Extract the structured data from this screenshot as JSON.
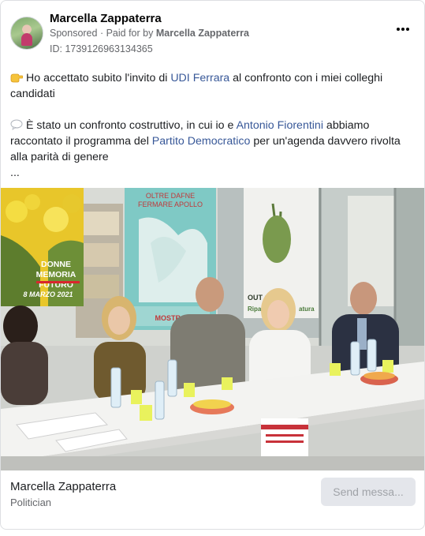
{
  "ad": {
    "advertiser_name": "Marcella Zappaterra",
    "sponsored_label": "Sponsored",
    "paid_for_prefix": "Paid for by",
    "paid_for_name": "Marcella Zappaterra",
    "ad_id": "ID: 1739126963134365",
    "more_icon": "more-options-icon"
  },
  "body": {
    "p1_before": "Ho accettato subito l'invito di ",
    "p1_link": "UDI Ferrara",
    "p1_after": " al confronto con i miei colleghi candidati",
    "p2_before": "È stato un confronto costruttivo, in cui io e ",
    "p2_link1": "Antonio Fiorentini",
    "p2_mid": " abbiamo raccontato il programma del ",
    "p2_link2": "Partito Democratico",
    "p2_after": " per un'agenda davvero rivolta alla parità di genere",
    "ellipsis": "...",
    "link_color": "#385898"
  },
  "photo": {
    "poster_left_line1": "DONNE",
    "poster_left_line2": "MEMORIA",
    "poster_left_line3": "FUTURO",
    "poster_left_date": "8 MARZO 2021",
    "poster_center_line1": "OLTRE DAFNE",
    "poster_center_line2": "FERMARE APOLLO",
    "poster_center_bottom": "MOSTRA",
    "poster_right_text": "OUT OF",
    "poster_right_text2": "Ripar",
    "poster_right_text3": "atura"
  },
  "footer": {
    "page_name": "Marcella Zappaterra",
    "page_category": "Politician",
    "cta_label": "Send messa..."
  }
}
